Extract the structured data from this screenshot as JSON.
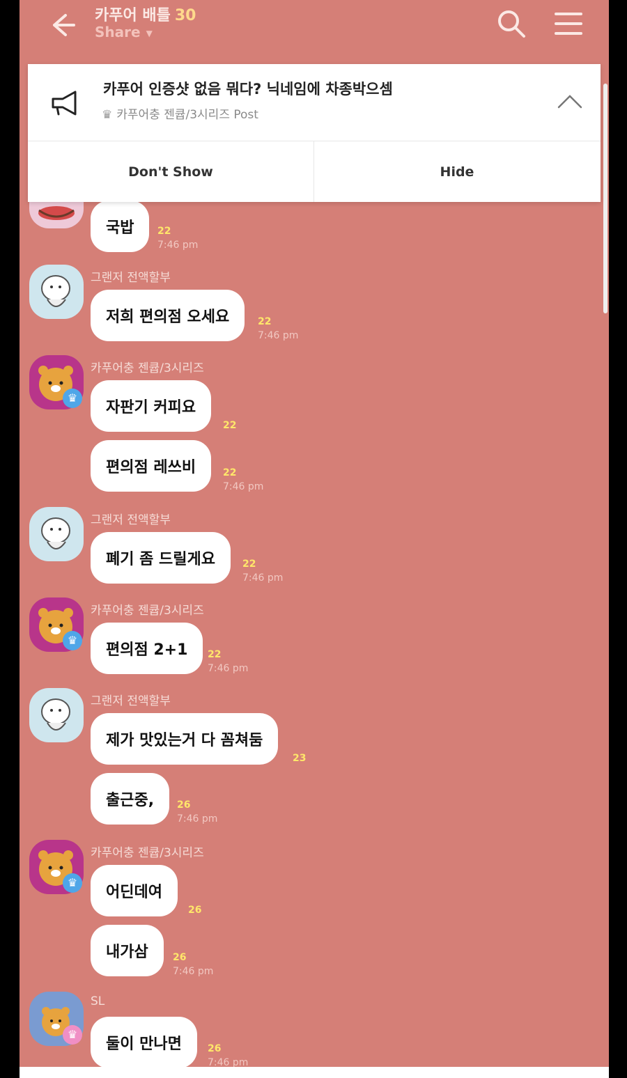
{
  "header": {
    "title": "카푸어 배틀",
    "member_count": "30",
    "share_label": "Share"
  },
  "notice": {
    "text": "카푸어 인증샷 없음 뭐다? 닉네임에 차종박으셈",
    "sub": "카푸어충 젠큡/3시리즈 Post",
    "dont_show": "Don't Show",
    "hide": "Hide"
  },
  "messages": [
    {
      "text": "국밥",
      "count": "22",
      "time": "7:46 pm"
    },
    {
      "sender": "그랜저 전액할부",
      "text": "저희 편의점 오세요",
      "count": "22",
      "time": "7:46 pm"
    },
    {
      "sender": "카푸어충 젠큡/3시리즈",
      "text": "자판기 커피요",
      "count": "22",
      "time": ""
    },
    {
      "text": "편의점 레쓰비",
      "count": "22",
      "time": "7:46 pm"
    },
    {
      "sender": "그랜저 전액할부",
      "text": "폐기 좀 드릴게요",
      "count": "22",
      "time": "7:46 pm"
    },
    {
      "sender": "카푸어충 젠큡/3시리즈",
      "text": "편의점 2+1",
      "count": "22",
      "time": "7:46 pm"
    },
    {
      "sender": "그랜저 전액할부",
      "text": "제가 맛있는거 다 꼼쳐둠",
      "count": "23",
      "time": ""
    },
    {
      "text": "출근중,",
      "count": "26",
      "time": "7:46 pm"
    },
    {
      "sender": "카푸어충 젠큡/3시리즈",
      "text": "어딘데여",
      "count": "26",
      "time": ""
    },
    {
      "text": "내가삼",
      "count": "26",
      "time": "7:46 pm"
    },
    {
      "sender": "SL",
      "text": "둘이 만나면",
      "count": "26",
      "time": "7:46 pm"
    }
  ],
  "colors": {
    "background": "#d57f77",
    "count": "#ffe76a",
    "bubble": "#ffffff"
  }
}
